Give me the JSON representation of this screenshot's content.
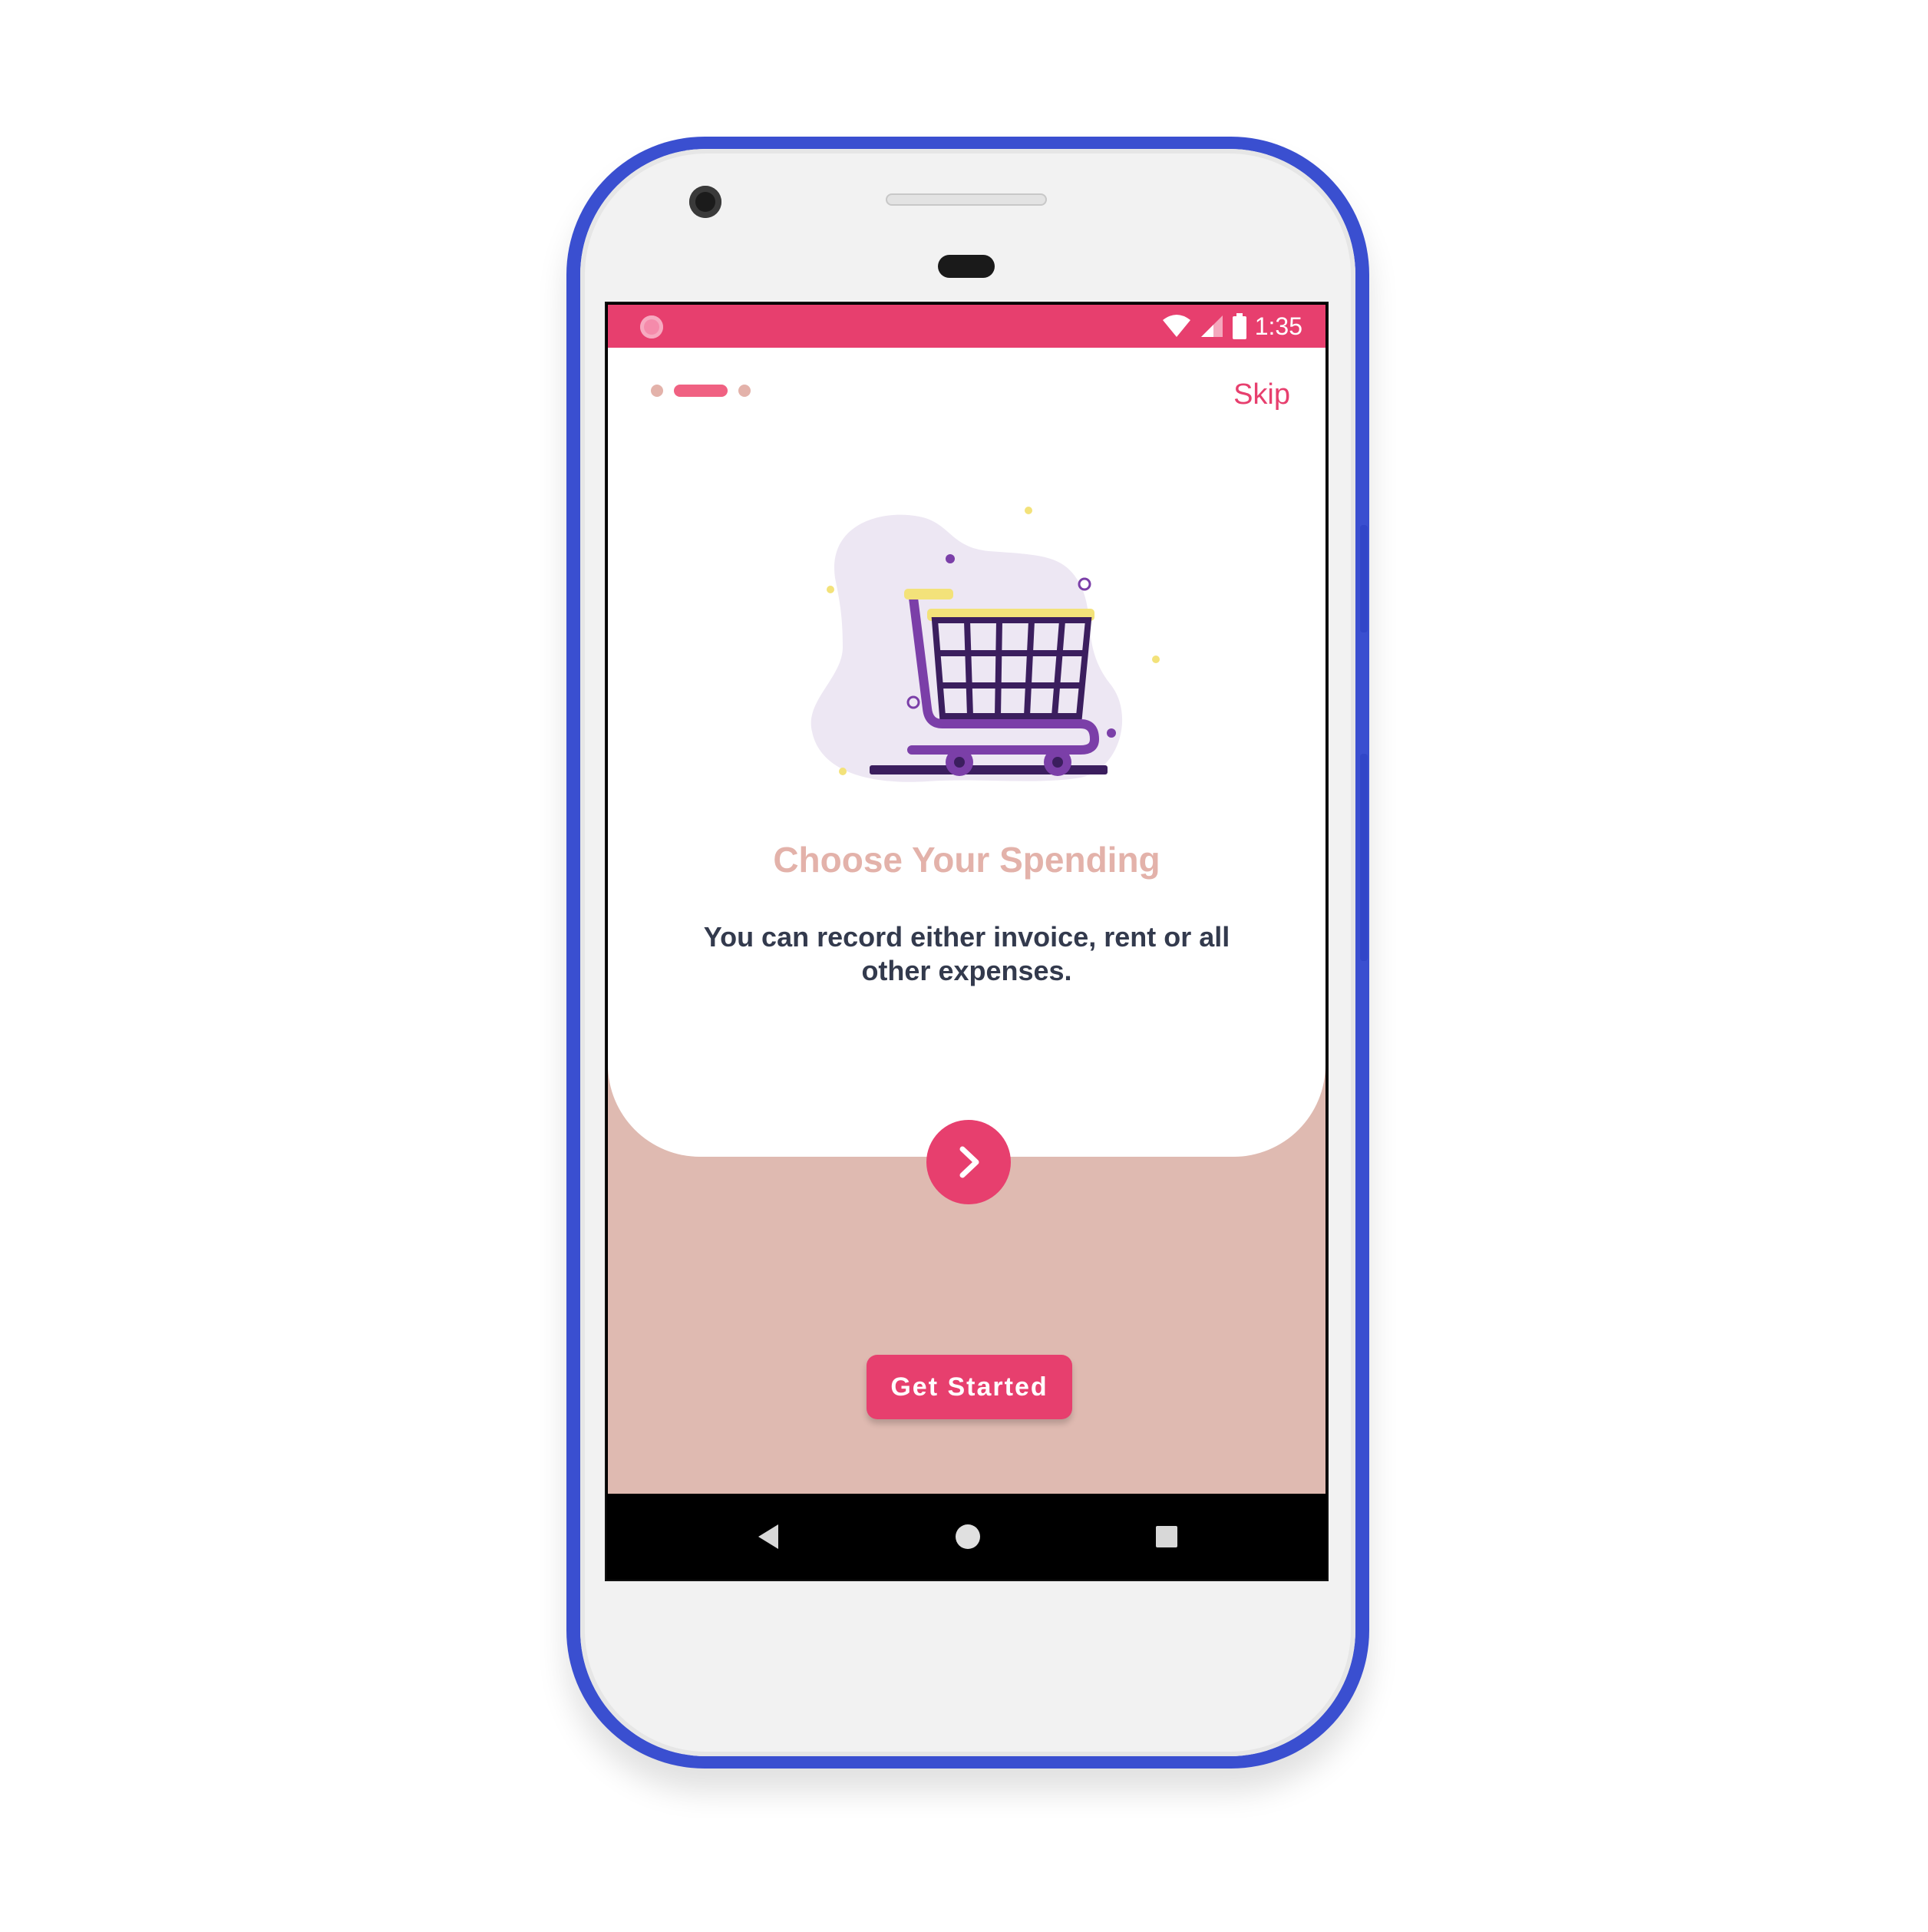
{
  "status_bar": {
    "time": "1:35"
  },
  "onboarding": {
    "skip_label": "Skip",
    "title": "Choose Your Spending",
    "description": "You can record either invoice, rent or all other expenses.",
    "get_started_label": "Get Started",
    "page_indicator": {
      "total": 3,
      "active_index": 1
    }
  },
  "colors": {
    "accent": "#e73f6e",
    "title": "#e3b2aa",
    "bottom_background": "#dfbab1",
    "phone_frame": "#3a4fd0"
  },
  "icons": {
    "next": "chevron-right-icon",
    "illustration": "shopping-cart-icon",
    "nav_back": "back-triangle-icon",
    "nav_home": "home-circle-icon",
    "nav_recent": "recent-square-icon"
  }
}
